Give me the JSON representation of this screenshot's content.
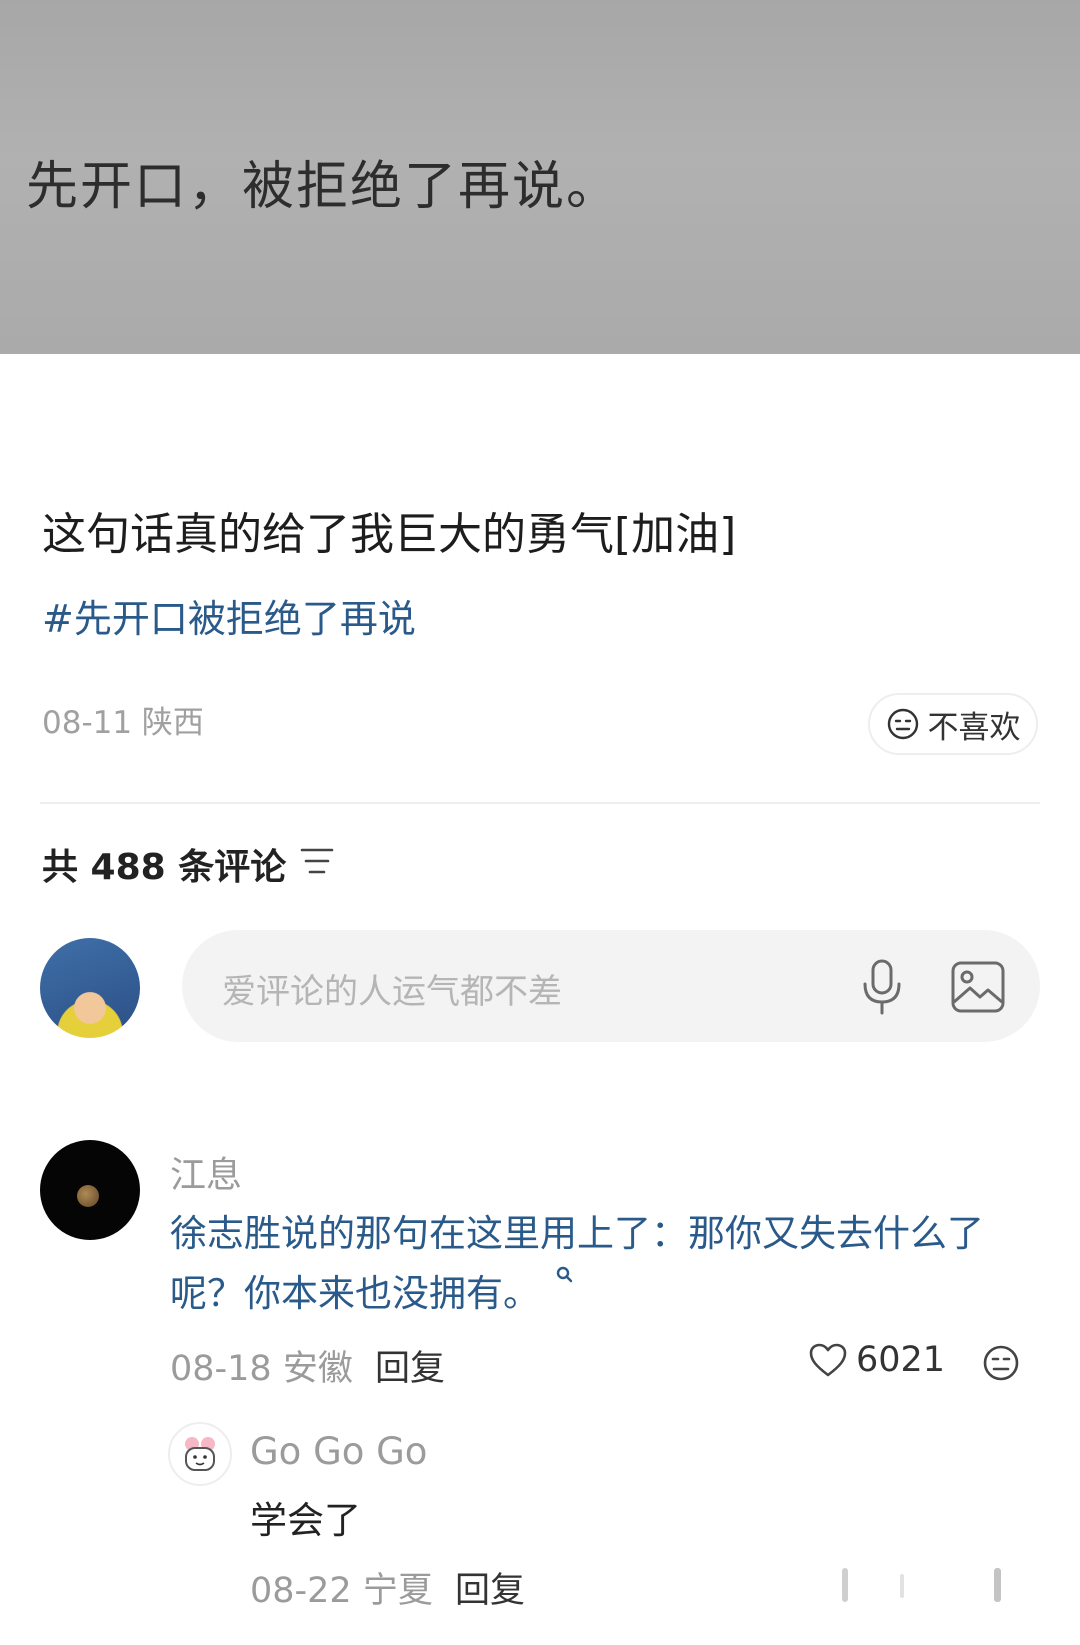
{
  "photo": {
    "caption": "先开口，被拒绝了再说。"
  },
  "post": {
    "text": "这句话真的给了我巨大的勇气[加油]",
    "hashtag": "#先开口被拒绝了再说",
    "meta": "08-11 陕西",
    "dislike_label": "不喜欢"
  },
  "comments_header": {
    "count_label": "共 488 条评论"
  },
  "comment_input": {
    "placeholder": "爱评论的人运气都不差"
  },
  "comments": [
    {
      "user": "江息",
      "text": "徐志胜说的那句在这里用上了：那你又失去什么了呢？你本来也没拥有。",
      "date": "08-18 安徽",
      "reply_label": "回复",
      "likes": "6021",
      "replies": [
        {
          "user": "Go Go Go",
          "text": "学会了",
          "date": "08-22 宁夏",
          "reply_label": "回复"
        }
      ]
    }
  ],
  "icons": {
    "dislike": "neutral-face-icon",
    "sort": "sort-lines-icon",
    "voice": "microphone-icon",
    "image": "image-icon",
    "like": "heart-icon",
    "comment_dislike": "neutral-face-icon"
  },
  "colors": {
    "link": "#2a5a8a",
    "secondary_text": "#9b9b9b",
    "input_bg": "#f3f3f3"
  }
}
